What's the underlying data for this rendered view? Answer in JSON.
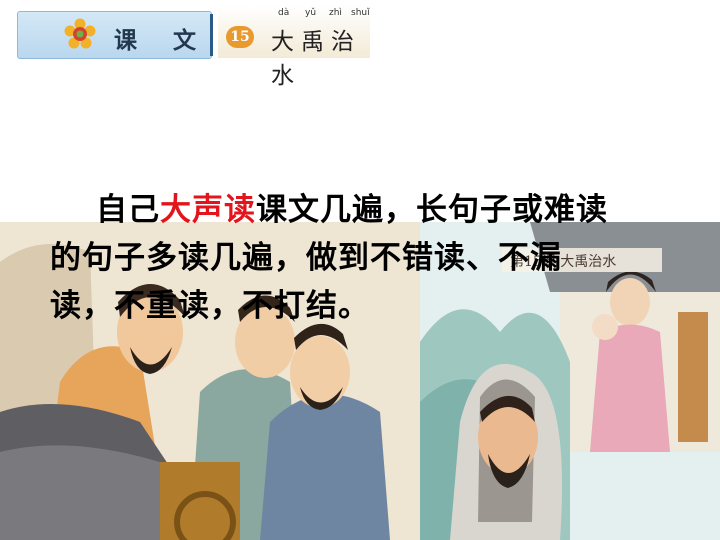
{
  "banner": {
    "section_label": "课 文",
    "lesson_number": "15",
    "lesson_title": "大禹治水",
    "pinyin": [
      "dà",
      "yǔ",
      "zhì",
      "shuǐ"
    ],
    "flower_icon": "flower-icon"
  },
  "instruction": {
    "line1_pre": "自己",
    "line1_highlight": "大声读",
    "line1_post": "课文几遍，长句子或难读",
    "line2": "的句子多读几遍，做到不错读、不漏",
    "line3": "读，不重读，不打结。"
  },
  "illustration": {
    "caption_text": "第15课 大禹治水"
  },
  "colors": {
    "highlight": "#e3141b",
    "text": "#000000",
    "banner_blue": "#b9d7ee",
    "lesson_badge": "#e89a2f"
  }
}
